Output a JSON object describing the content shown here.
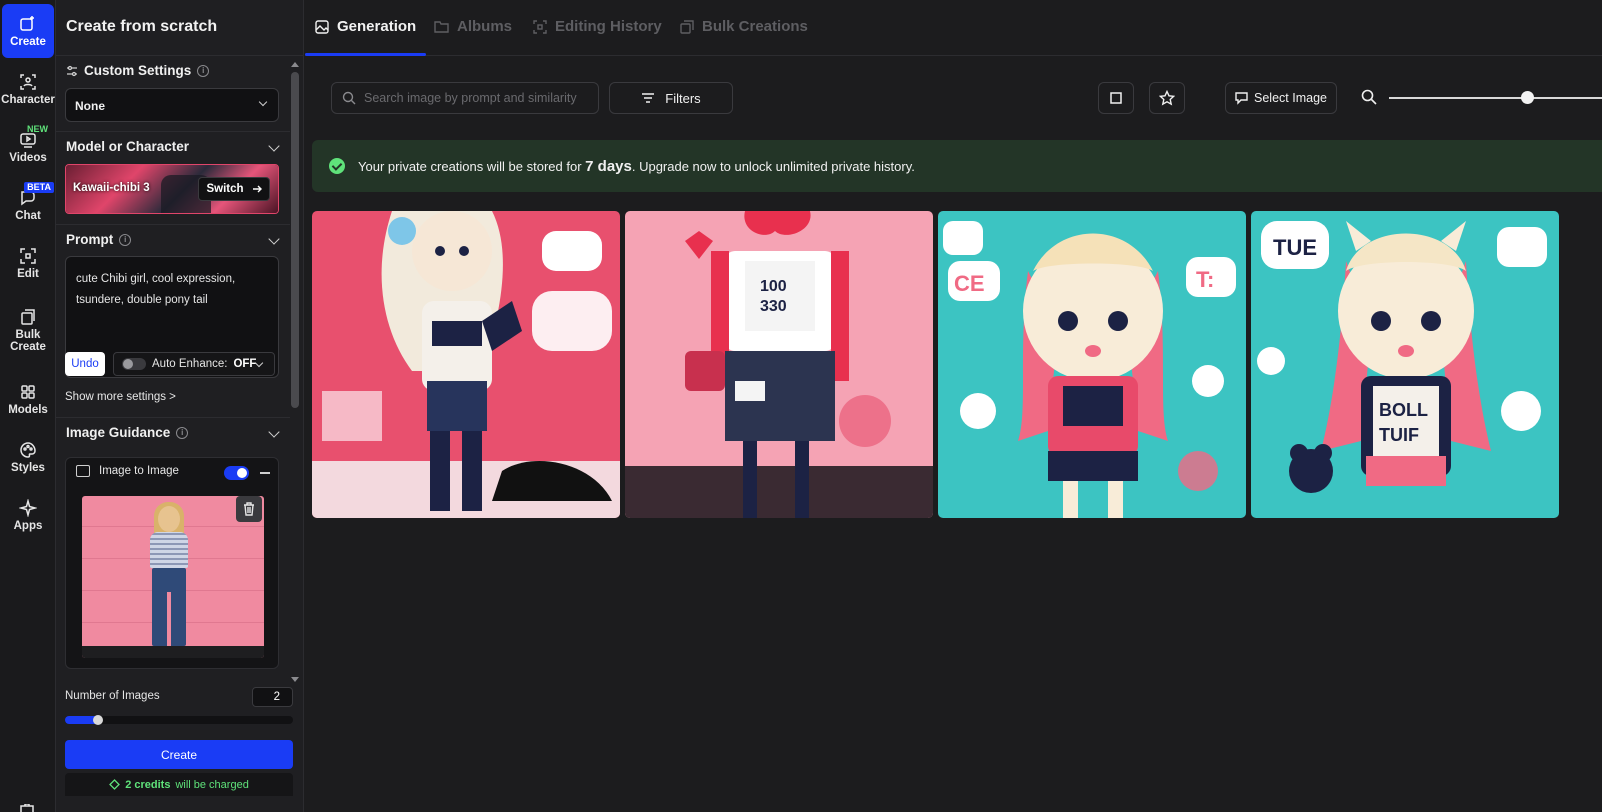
{
  "rail": {
    "items": [
      {
        "label": "Create",
        "icon": "sparkle-edit-icon"
      },
      {
        "label": "Character",
        "icon": "character-icon"
      },
      {
        "label": "Videos",
        "icon": "video-icon",
        "badge": "NEW"
      },
      {
        "label": "Chat",
        "icon": "chat-icon",
        "badge": "BETA"
      },
      {
        "label": "Edit",
        "icon": "edit-icon"
      },
      {
        "label": "Bulk Create",
        "icon": "bulk-create-icon"
      },
      {
        "label": "Models",
        "icon": "models-grid-icon"
      },
      {
        "label": "Styles",
        "icon": "palette-icon"
      },
      {
        "label": "Apps",
        "icon": "apps-sparkle-icon"
      }
    ]
  },
  "panel": {
    "title": "Create from scratch",
    "custom_settings": {
      "label": "Custom Settings",
      "value": "None"
    },
    "model": {
      "label": "Model or Character",
      "name": "Kawaii-chibi 3",
      "switch_label": "Switch"
    },
    "prompt": {
      "label": "Prompt",
      "text": "cute Chibi girl, cool expression, tsundere, double pony tail",
      "undo_label": "Undo",
      "enhance_label": "Auto Enhance:",
      "enhance_value": "OFF"
    },
    "show_more": "Show more settings >",
    "guidance": {
      "label": "Image Guidance",
      "i2i_label": "Image to Image",
      "i2i_enabled": true
    },
    "num_images": {
      "label": "Number of Images",
      "value": "2"
    },
    "create_label": "Create",
    "credits": {
      "amount": "2 credits",
      "suffix": "will be charged"
    }
  },
  "main": {
    "tabs": [
      {
        "label": "Generation",
        "active": true
      },
      {
        "label": "Albums",
        "active": false
      },
      {
        "label": "Editing History",
        "active": false
      },
      {
        "label": "Bulk Creations",
        "active": false
      }
    ],
    "search_placeholder": "Search image by prompt and similarity",
    "filters_label": "Filters",
    "select_image_label": "Select Image",
    "zoom_level": 0.65,
    "banner": {
      "prefix": "Your private creations will be stored for",
      "highlight": "7 days",
      "suffix": ". Upgrade now to unlock unlimited private history."
    },
    "images": [
      {
        "name": "generated-image-1",
        "palette": [
          "#e8506e",
          "#1c2244",
          "#f4dde0"
        ]
      },
      {
        "name": "generated-image-2",
        "palette": [
          "#f5a3b4",
          "#ffffff",
          "#2a2a3a"
        ]
      },
      {
        "name": "generated-image-3",
        "palette": [
          "#3cc4c2",
          "#f06a84",
          "#1c2244"
        ]
      },
      {
        "name": "generated-image-4",
        "palette": [
          "#3cc4c2",
          "#f06a84",
          "#1c2244"
        ]
      }
    ]
  },
  "colors": {
    "accent": "#1a3cf5",
    "success": "#5fe27a",
    "banner_bg": "#233527"
  }
}
